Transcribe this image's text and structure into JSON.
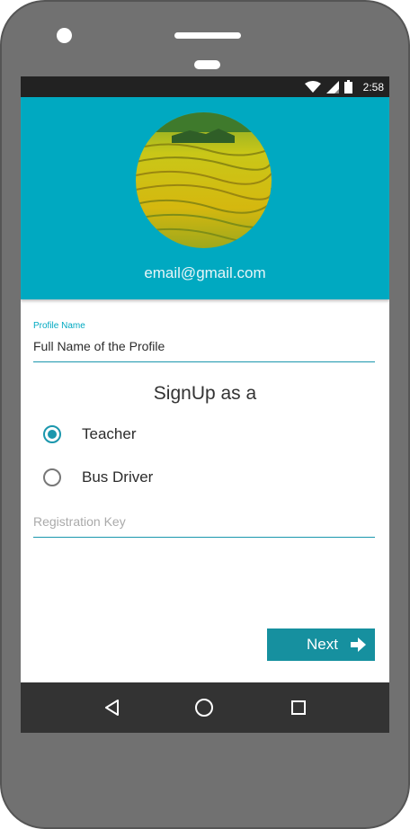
{
  "status_bar": {
    "time": "2:58",
    "icons": [
      "wifi-icon",
      "signal-icon",
      "battery-icon"
    ]
  },
  "header": {
    "avatar_image": "terraced-fields-avatar",
    "email": "email@gmail.com",
    "background_color": "#00a9c1"
  },
  "profile_name": {
    "label": "Profile Name",
    "value": "Full Name of the Profile"
  },
  "signup": {
    "title": "SignUp as a",
    "options": [
      {
        "label": "Teacher",
        "selected": true
      },
      {
        "label": "Bus Driver",
        "selected": false
      }
    ]
  },
  "registration_key": {
    "placeholder": "Registration Key",
    "value": ""
  },
  "next_button": {
    "label": "Next",
    "icon": "arrow-right-icon",
    "color": "#16909f"
  },
  "nav_bar": {
    "buttons": [
      "back-icon",
      "home-icon",
      "recents-icon"
    ]
  }
}
